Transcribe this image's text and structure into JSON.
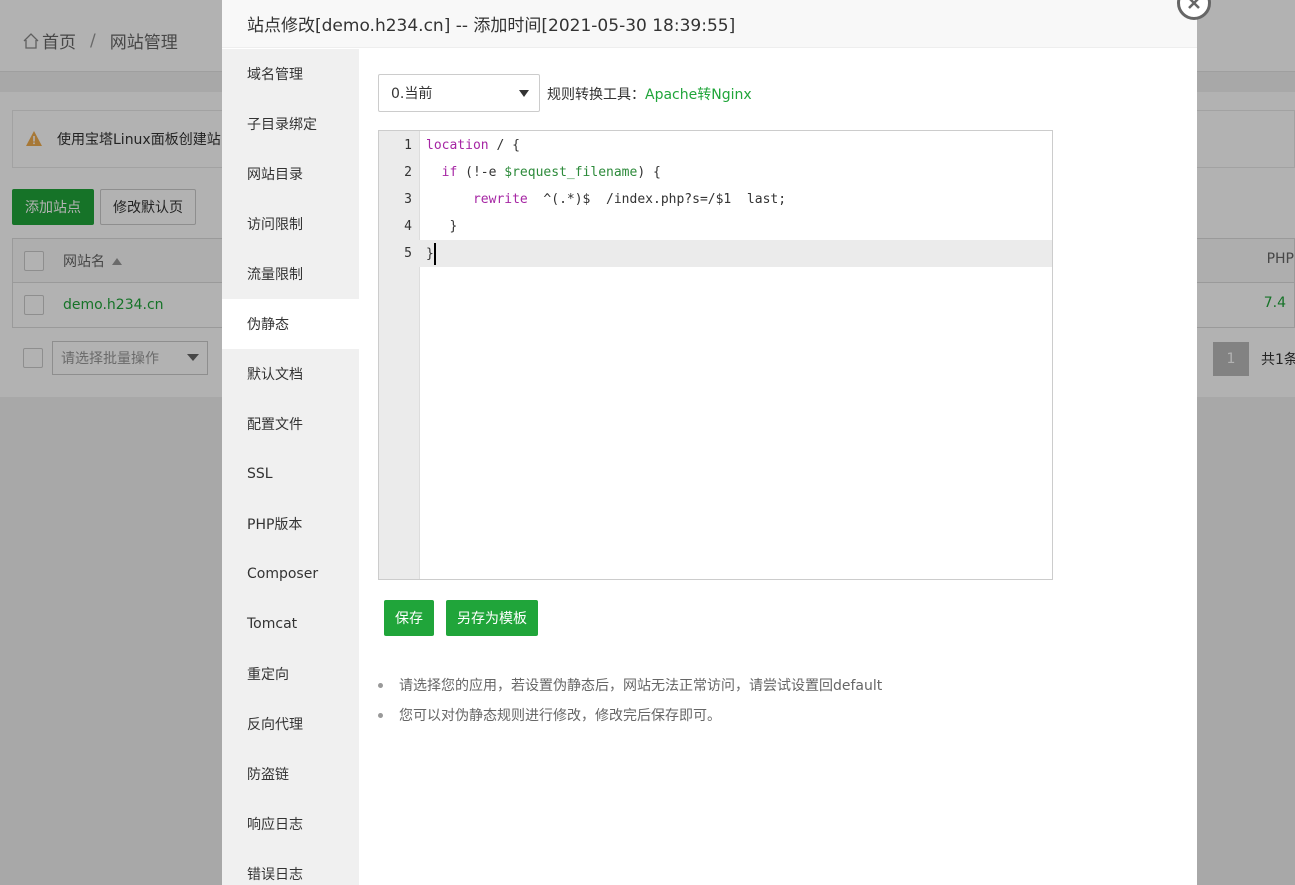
{
  "background": {
    "breadcrumb": {
      "home": "首页",
      "separator": "/",
      "current": "网站管理"
    },
    "alert_text": "使用宝塔Linux面板创建站",
    "buttons": {
      "add_site": "添加站点",
      "edit_default": "修改默认页"
    },
    "table": {
      "col_name": "网站名",
      "col_php": "PHP",
      "rows": [
        {
          "name": "demo.h234.cn",
          "php": "7.4"
        }
      ]
    },
    "batch_placeholder": "请选择批量操作",
    "pager": {
      "current": "1",
      "total_text": "共1条"
    }
  },
  "modal": {
    "title": "站点修改[demo.h234.cn] -- 添加时间[2021-05-30 18:39:55]",
    "menu": [
      {
        "label": "域名管理"
      },
      {
        "label": "子目录绑定"
      },
      {
        "label": "网站目录"
      },
      {
        "label": "访问限制"
      },
      {
        "label": "流量限制"
      },
      {
        "label": "伪静态"
      },
      {
        "label": "默认文档"
      },
      {
        "label": "配置文件"
      },
      {
        "label": "SSL"
      },
      {
        "label": "PHP版本"
      },
      {
        "label": "Composer"
      },
      {
        "label": "Tomcat"
      },
      {
        "label": "重定向"
      },
      {
        "label": "反向代理"
      },
      {
        "label": "防盗链"
      },
      {
        "label": "响应日志"
      },
      {
        "label": "错误日志"
      }
    ],
    "active_menu": "伪静态",
    "version_select": "0.当前",
    "convert_label": "规则转换工具：",
    "convert_link": "Apache转Nginx",
    "code_lines": [
      {
        "num": "1"
      },
      {
        "num": "2"
      },
      {
        "num": "3"
      },
      {
        "num": "4"
      },
      {
        "num": "5"
      }
    ],
    "code": {
      "l1_kw": "location",
      "l1_rest": " / {",
      "l2_kw": "if",
      "l2_mid": " (!-e ",
      "l2_var": "$request_filename",
      "l2_rest": ") {",
      "l3_kw": "rewrite",
      "l3_rest": "  ^(.*)$  /index.php?s=/$1  last;",
      "l4": "}",
      "l5": "}"
    },
    "save_label": "保存",
    "save_template_label": "另存为模板",
    "tips": [
      "请选择您的应用，若设置伪静态后，网站无法正常访问，请尝试设置回default",
      "您可以对伪静态规则进行修改，修改完后保存即可。"
    ]
  },
  "colors": {
    "accent": "#20a53a",
    "keyword": "#a626a4",
    "variable": "#2c8a3a"
  }
}
